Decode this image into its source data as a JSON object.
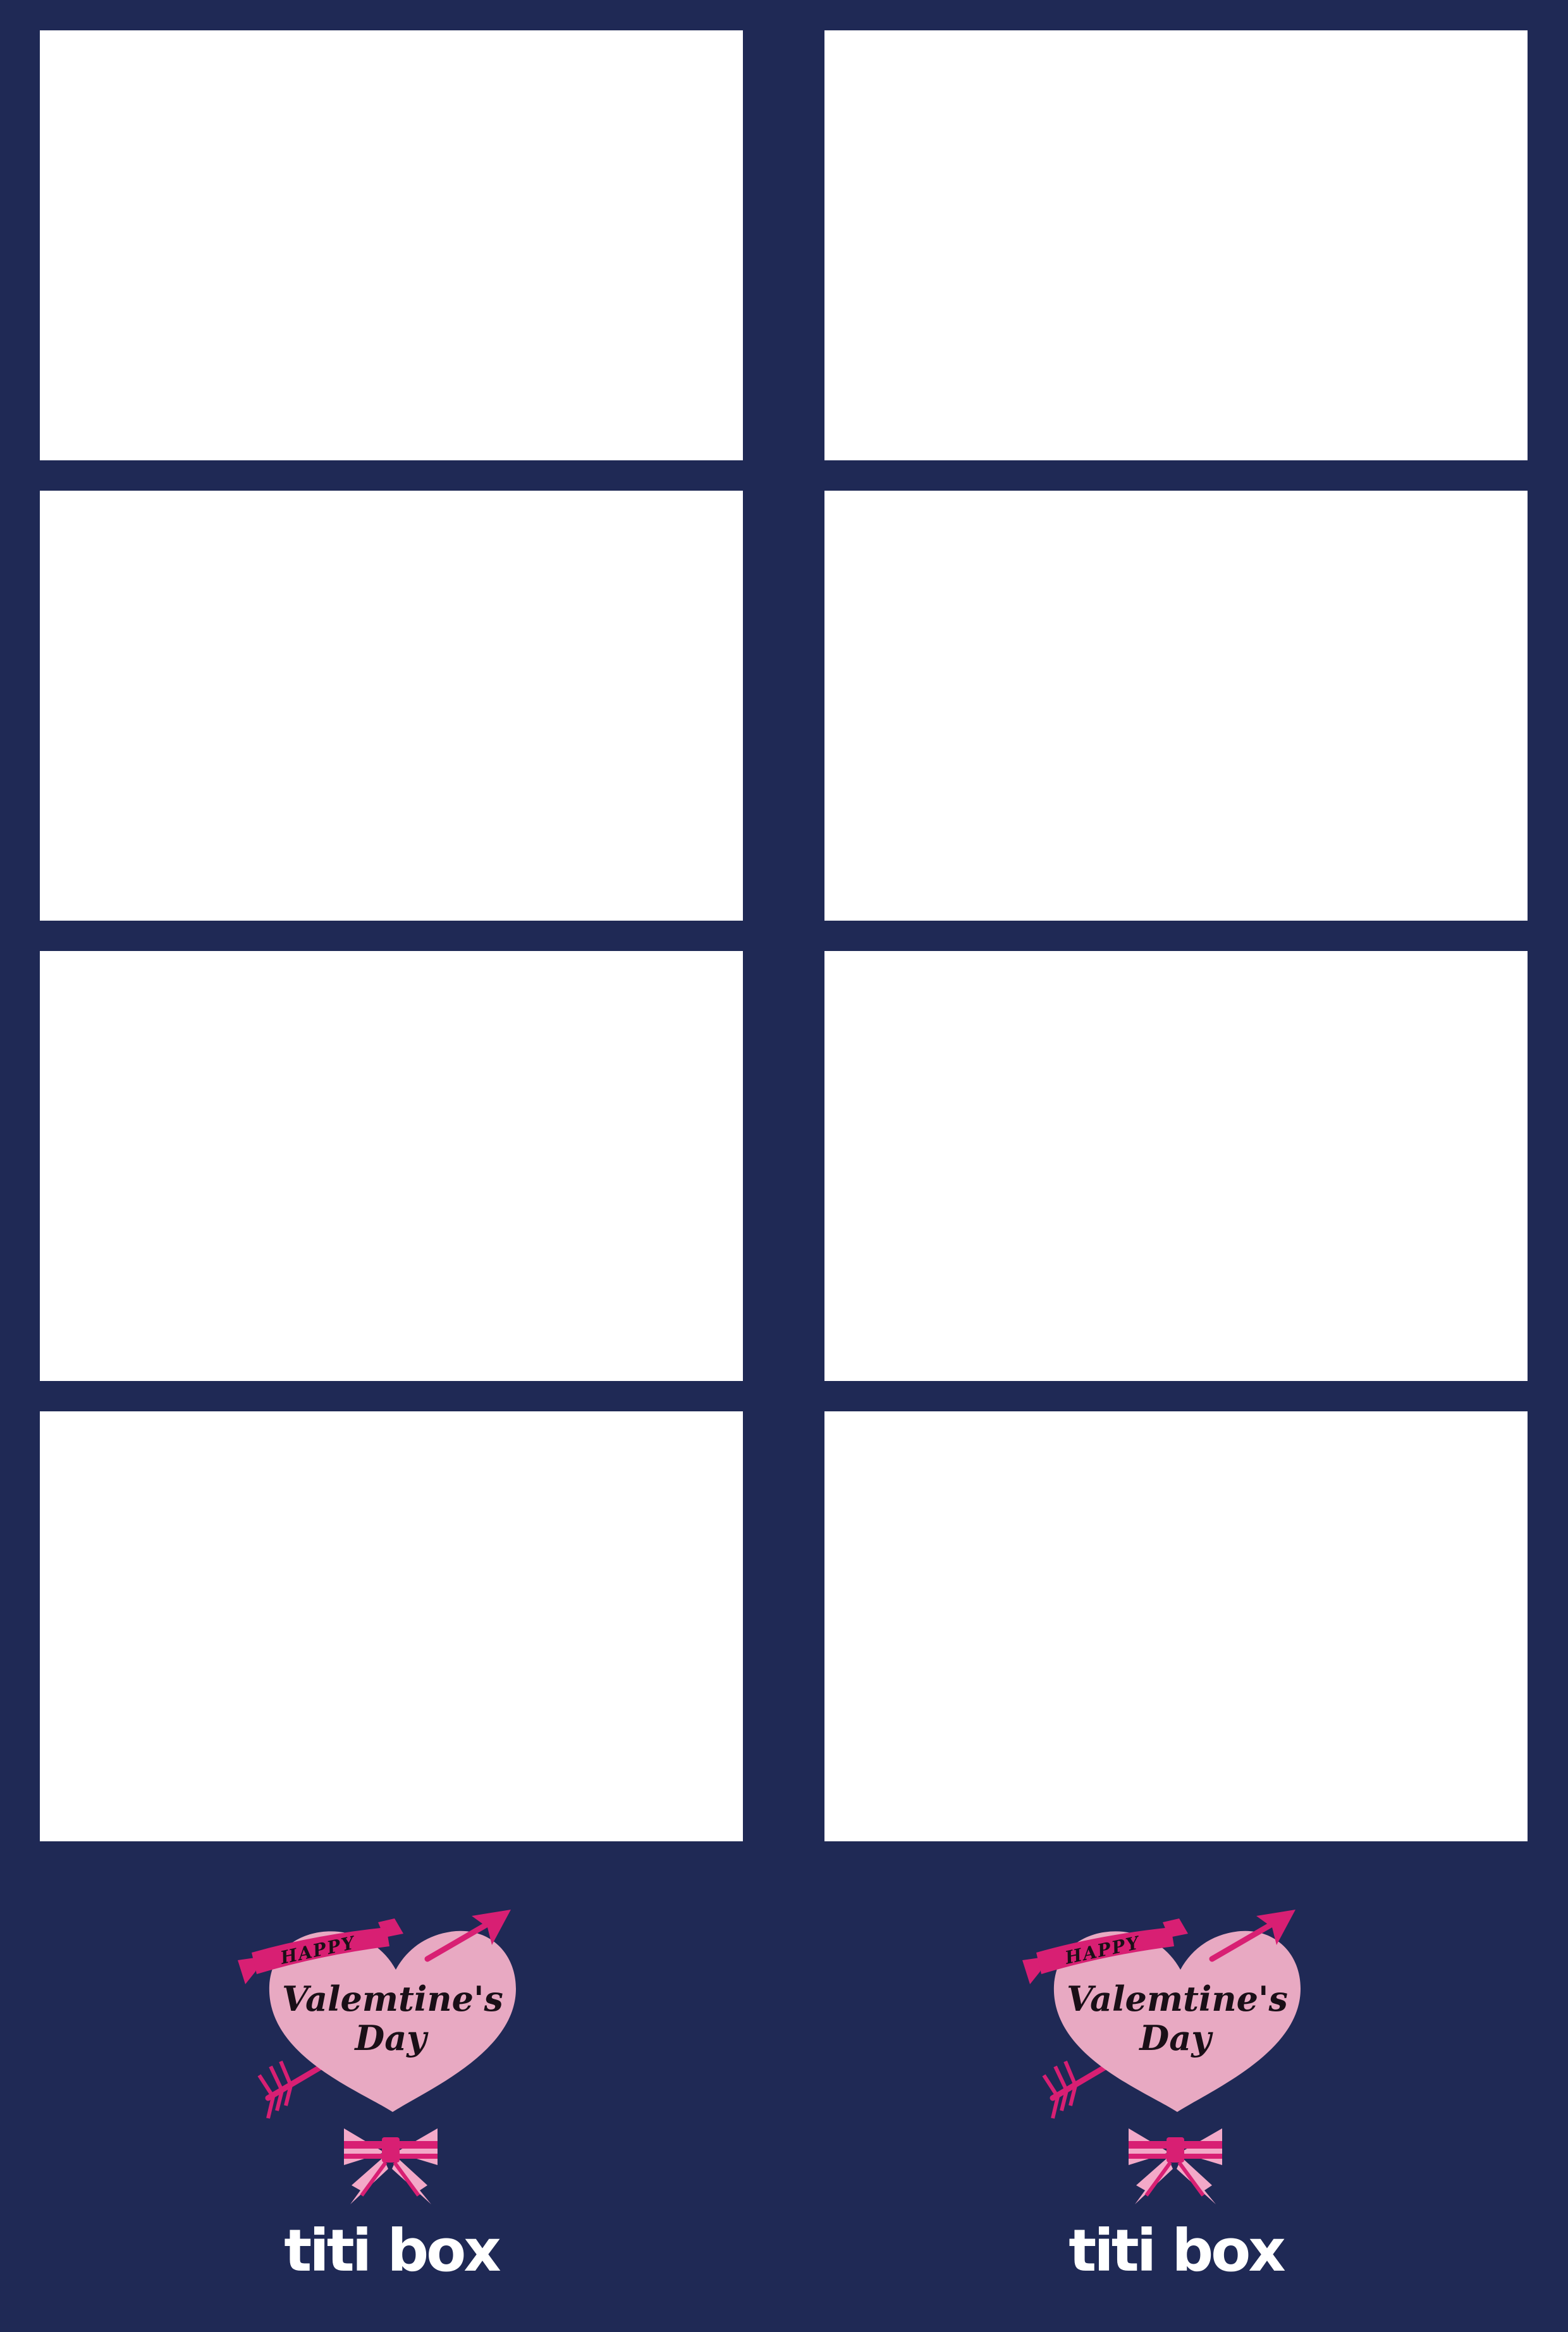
{
  "colors": {
    "background": "#1f2955",
    "photo_slot": "#ffffff",
    "heart": "#e8a9c2",
    "ribbon": "#d81f73",
    "bow_light": "#f3a9c8"
  },
  "strips": [
    {
      "emblem": {
        "ribbon_text": "HAPPY",
        "line1": "Valemtine's",
        "line2": "Day"
      },
      "brand": "titi box"
    },
    {
      "emblem": {
        "ribbon_text": "HAPPY",
        "line1": "Valemtine's",
        "line2": "Day"
      },
      "brand": "titi box"
    }
  ]
}
